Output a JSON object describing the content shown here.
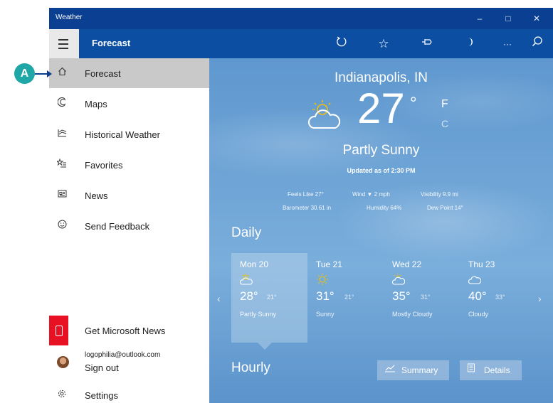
{
  "window": {
    "title": "Weather",
    "controls": {
      "minimize": "–",
      "maximize": "□",
      "close": "✕"
    }
  },
  "appbar": {
    "title": "Forecast",
    "icons": [
      "refresh-icon",
      "favorite-star-icon",
      "pin-icon",
      "dark-mode-moon-icon",
      "more-icon",
      "search-icon"
    ]
  },
  "callout": {
    "label": "A"
  },
  "nav": {
    "items": [
      {
        "label": "Forecast",
        "icon": "home-icon"
      },
      {
        "label": "Maps",
        "icon": "maps-icon"
      },
      {
        "label": "Historical Weather",
        "icon": "historical-icon"
      },
      {
        "label": "Favorites",
        "icon": "favorites-list-icon"
      },
      {
        "label": "News",
        "icon": "news-icon"
      },
      {
        "label": "Send Feedback",
        "icon": "smiley-icon"
      }
    ],
    "bottom": {
      "get_news": "Get Microsoft News",
      "email": "logophilia@outlook.com",
      "sign_out": "Sign out",
      "settings": "Settings"
    }
  },
  "current": {
    "city": "Indianapolis, IN",
    "temp": "27",
    "deg": "°",
    "unit_f": "F",
    "unit_c": "C",
    "condition": "Partly Sunny",
    "updated": "Updated as of 2:30 PM",
    "details": {
      "feels_like": "Feels Like  27°",
      "wind": "Wind  ▼ 2 mph",
      "visibility": "Visibility  9.9 mi",
      "barometer": "Barometer  30.61 in",
      "humidity": "Humidity  64%",
      "dew_point": "Dew Point  14°"
    }
  },
  "daily": {
    "title": "Daily",
    "days": [
      {
        "name": "Mon 20",
        "hi": "28°",
        "lo": "21°",
        "cond": "Partly Sunny",
        "icon": "partly-sunny-icon"
      },
      {
        "name": "Tue 21",
        "hi": "31°",
        "lo": "21°",
        "cond": "Sunny",
        "icon": "sunny-icon"
      },
      {
        "name": "Wed 22",
        "hi": "35°",
        "lo": "31°",
        "cond": "Mostly Cloudy",
        "icon": "mostly-cloudy-icon"
      },
      {
        "name": "Thu 23",
        "hi": "40°",
        "lo": "33°",
        "cond": "Cloudy",
        "icon": "cloudy-icon"
      }
    ]
  },
  "hourly": {
    "title": "Hourly",
    "summary_label": "Summary",
    "details_label": "Details"
  },
  "colors": {
    "titlebar": "#0b3f91",
    "appbar": "#0b4ea2",
    "news_tile": "#e81123",
    "callout": "#1fa6a6",
    "sun": "#f2c200"
  }
}
